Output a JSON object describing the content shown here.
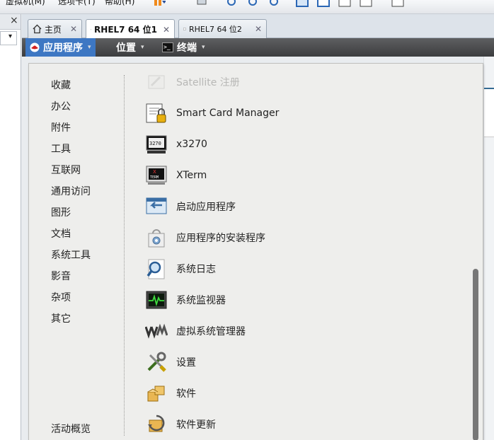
{
  "menubar": {
    "items": [
      "虚拟机(M)",
      "选项卡(T)",
      "帮助(H)"
    ]
  },
  "library": {
    "close_label": "×",
    "dropdown_caret": "▾"
  },
  "tabs": [
    {
      "label": "主页",
      "close": "✕"
    },
    {
      "label": "RHEL7 64 位1",
      "close": "✕"
    },
    {
      "label": "RHEL7 64 位2",
      "close": "✕"
    }
  ],
  "gnome_bar": {
    "applications": "应用程序",
    "places": "位置",
    "terminal": "终端",
    "caret": "▾"
  },
  "categories": [
    "收藏",
    "办公",
    "附件",
    "工具",
    "互联网",
    "通用访问",
    "图形",
    "文档",
    "系统工具",
    "影音",
    "杂项",
    "其它"
  ],
  "activities": "活动概览",
  "apps": [
    {
      "label": "Satellite 注册",
      "icon": "satellite-icon",
      "dimmed": true
    },
    {
      "label": "Smart Card Manager",
      "icon": "smartcard-icon"
    },
    {
      "label": "x3270",
      "icon": "x3270-icon"
    },
    {
      "label": "XTerm",
      "icon": "xterm-icon"
    },
    {
      "label": "启动应用程序",
      "icon": "startup-apps-icon"
    },
    {
      "label": "应用程序的安装程序",
      "icon": "app-installer-icon"
    },
    {
      "label": "系统日志",
      "icon": "system-log-icon"
    },
    {
      "label": "系统监视器",
      "icon": "system-monitor-icon"
    },
    {
      "label": "虚拟系统管理器",
      "icon": "virt-manager-icon"
    },
    {
      "label": "设置",
      "icon": "settings-icon"
    },
    {
      "label": "软件",
      "icon": "software-icon"
    },
    {
      "label": "软件更新",
      "icon": "software-update-icon"
    }
  ],
  "colors": {
    "highlight": "#f7f500",
    "active_menu": "#3d77c3"
  }
}
